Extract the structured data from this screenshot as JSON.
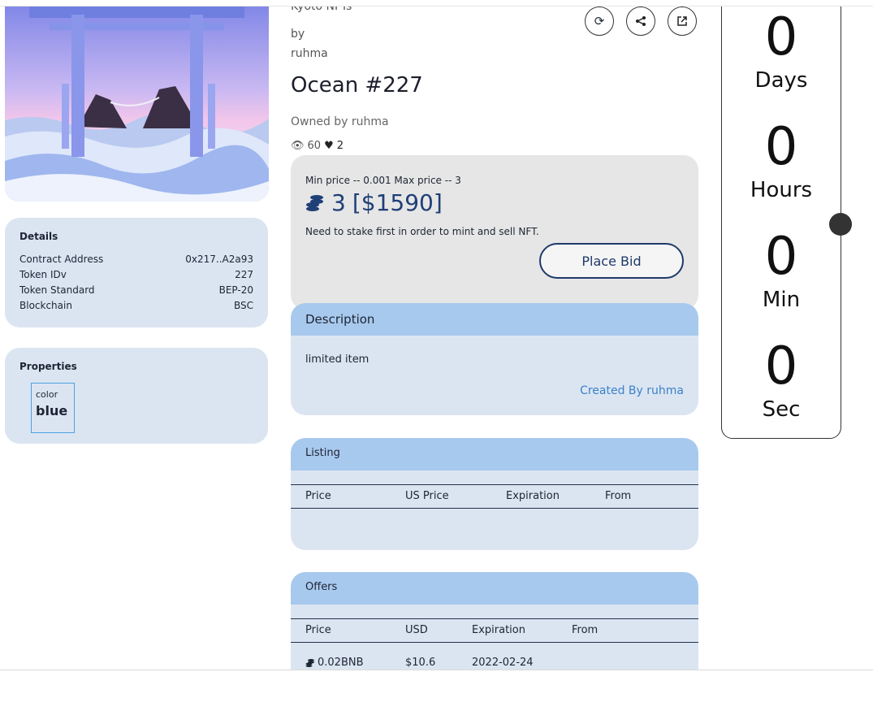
{
  "item": {
    "collection": "Kyoto NFTs",
    "by_label": "by",
    "creator": "ruhma",
    "title": "Ocean #227",
    "owned_by": "Owned by ruhma",
    "views": "60",
    "likes": "2"
  },
  "actions": {
    "refresh_icon": "refresh-icon",
    "share_icon": "share-icon",
    "external_icon": "external-link-icon"
  },
  "price": {
    "min_max": "Min price -- 0.001  Max price -- 3",
    "amount": "3",
    "usd": "[$1590]",
    "stake_note": "Need to stake first in order to mint and sell NFT.",
    "bid_label": "Place Bid"
  },
  "description": {
    "heading": "Description",
    "text": "limited item",
    "created_by": "Created By ruhma"
  },
  "details": {
    "heading": "Details",
    "rows": [
      {
        "label": "Contract Address",
        "value": "0x217..A2a93"
      },
      {
        "label": "Token IDv",
        "value": "227"
      },
      {
        "label": "Token Standard",
        "value": "BEP-20"
      },
      {
        "label": "Blockchain",
        "value": "BSC"
      }
    ]
  },
  "properties": {
    "heading": "Properties",
    "key": "color",
    "value": "blue"
  },
  "listing": {
    "heading": "Listing",
    "columns": [
      "Price",
      "US Price",
      "Expiration",
      "From"
    ]
  },
  "offers": {
    "heading": "Offers",
    "columns": [
      "Price",
      "USD",
      "Expiration",
      "From"
    ],
    "rows": [
      {
        "price": "0.02BNB",
        "usd": "$10.6",
        "expiration": "2022-02-24",
        "from": ""
      }
    ]
  },
  "countdown": {
    "days": "0",
    "days_label": "Days",
    "hours": "0",
    "hours_label": "Hours",
    "min": "0",
    "min_label": "Min",
    "sec": "0",
    "sec_label": "Sec"
  },
  "colors": {
    "accent": "#a8c9ee",
    "card": "#dbe5f2",
    "price_text": "#1f3f77",
    "link": "#3b82c8"
  }
}
